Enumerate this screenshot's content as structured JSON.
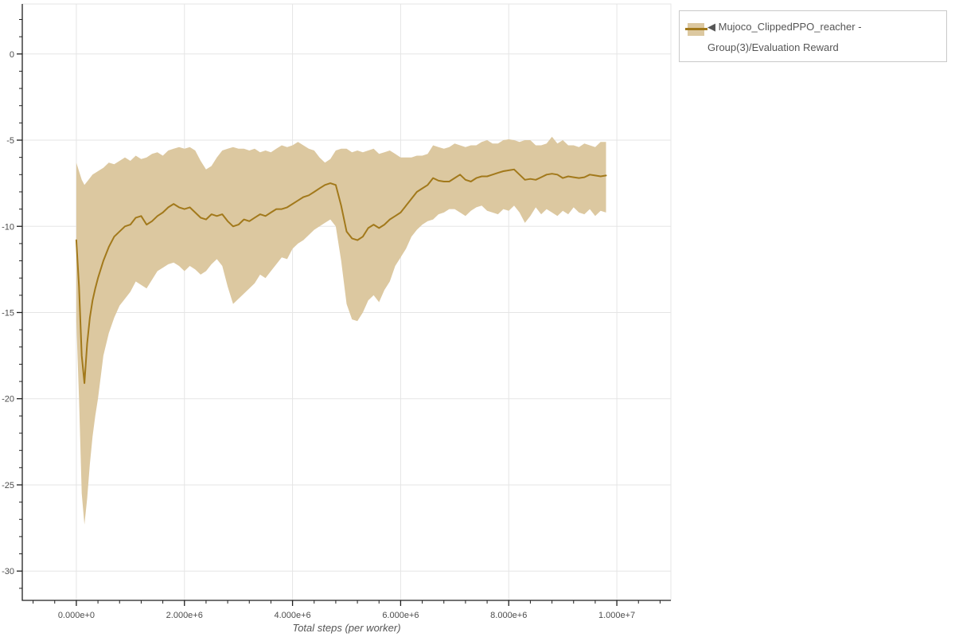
{
  "legend": {
    "label": "◀ Mujoco_ClippedPPO_reacher - Group(3)/Evaluation Reward",
    "swatch_fill": "#dcc8a0",
    "swatch_line": "#a2791b"
  },
  "chart_data": {
    "type": "line",
    "title": "",
    "xlabel": "Total steps (per worker)",
    "ylabel": "",
    "series": [
      {
        "name": "Mujoco_ClippedPPO_reacher - Group(3)/Evaluation Reward",
        "x_unit_steps": 1000000,
        "x_e6": [
          0,
          0.05,
          0.1,
          0.15,
          0.2,
          0.25,
          0.3,
          0.35,
          0.4,
          0.5,
          0.6,
          0.7,
          0.8,
          0.9,
          1.0,
          1.1,
          1.2,
          1.3,
          1.4,
          1.5,
          1.6,
          1.7,
          1.8,
          1.9,
          2.0,
          2.1,
          2.2,
          2.3,
          2.4,
          2.5,
          2.6,
          2.7,
          2.8,
          2.9,
          3.0,
          3.1,
          3.2,
          3.3,
          3.4,
          3.5,
          3.6,
          3.7,
          3.8,
          3.9,
          4.0,
          4.1,
          4.2,
          4.3,
          4.4,
          4.5,
          4.6,
          4.7,
          4.8,
          4.9,
          5.0,
          5.1,
          5.2,
          5.3,
          5.4,
          5.5,
          5.6,
          5.7,
          5.8,
          5.9,
          6.0,
          6.1,
          6.2,
          6.3,
          6.4,
          6.5,
          6.6,
          6.7,
          6.8,
          6.9,
          7.0,
          7.1,
          7.2,
          7.3,
          7.4,
          7.5,
          7.6,
          7.7,
          7.8,
          7.9,
          8.0,
          8.1,
          8.2,
          8.3,
          8.4,
          8.5,
          8.6,
          8.7,
          8.8,
          8.9,
          9.0,
          9.1,
          9.2,
          9.3,
          9.4,
          9.5,
          9.6,
          9.7,
          9.8
        ],
        "mean": [
          -10.8,
          -13.5,
          -17.5,
          -19.1,
          -16.8,
          -15.3,
          -14.3,
          -13.6,
          -13.0,
          -12.0,
          -11.2,
          -10.6,
          -10.3,
          -10.0,
          -9.9,
          -9.5,
          -9.4,
          -9.9,
          -9.7,
          -9.4,
          -9.2,
          -8.9,
          -8.7,
          -8.9,
          -9.0,
          -8.9,
          -9.2,
          -9.5,
          -9.6,
          -9.3,
          -9.4,
          -9.3,
          -9.7,
          -10.0,
          -9.9,
          -9.6,
          -9.7,
          -9.5,
          -9.3,
          -9.4,
          -9.2,
          -9.0,
          -9.0,
          -8.9,
          -8.7,
          -8.5,
          -8.3,
          -8.2,
          -8.0,
          -7.8,
          -7.6,
          -7.5,
          -7.6,
          -8.8,
          -10.3,
          -10.7,
          -10.8,
          -10.6,
          -10.1,
          -9.9,
          -10.1,
          -9.9,
          -9.6,
          -9.4,
          -9.2,
          -8.8,
          -8.4,
          -8.0,
          -7.8,
          -7.6,
          -7.2,
          -7.35,
          -7.4,
          -7.4,
          -7.2,
          -7.0,
          -7.3,
          -7.4,
          -7.2,
          -7.1,
          -7.1,
          -7.0,
          -6.9,
          -6.8,
          -6.75,
          -6.7,
          -7.0,
          -7.3,
          -7.25,
          -7.3,
          -7.15,
          -7.0,
          -6.95,
          -7.0,
          -7.2,
          -7.1,
          -7.15,
          -7.2,
          -7.15,
          -7.0,
          -7.05,
          -7.1,
          -7.05
        ],
        "band_upper": [
          -6.3,
          -6.8,
          -7.3,
          -7.6,
          -7.4,
          -7.2,
          -7.0,
          -6.9,
          -6.8,
          -6.6,
          -6.3,
          -6.4,
          -6.2,
          -6.0,
          -6.2,
          -5.9,
          -6.1,
          -6.0,
          -5.8,
          -5.7,
          -5.9,
          -5.6,
          -5.5,
          -5.4,
          -5.5,
          -5.4,
          -5.6,
          -6.2,
          -6.7,
          -6.5,
          -6.0,
          -5.6,
          -5.5,
          -5.4,
          -5.5,
          -5.5,
          -5.6,
          -5.5,
          -5.7,
          -5.6,
          -5.7,
          -5.5,
          -5.3,
          -5.4,
          -5.3,
          -5.1,
          -5.3,
          -5.5,
          -5.6,
          -6.0,
          -6.3,
          -6.1,
          -5.6,
          -5.5,
          -5.5,
          -5.7,
          -5.6,
          -5.7,
          -5.6,
          -5.5,
          -5.8,
          -5.7,
          -5.6,
          -5.8,
          -6.0,
          -6.0,
          -6.0,
          -5.9,
          -5.9,
          -5.8,
          -5.3,
          -5.4,
          -5.5,
          -5.4,
          -5.2,
          -5.3,
          -5.4,
          -5.3,
          -5.3,
          -5.1,
          -5.0,
          -5.2,
          -5.2,
          -5.0,
          -4.95,
          -5.0,
          -5.1,
          -5.0,
          -5.0,
          -5.3,
          -5.3,
          -5.2,
          -4.8,
          -5.2,
          -5.0,
          -5.3,
          -5.3,
          -5.4,
          -5.2,
          -5.3,
          -5.4,
          -5.1,
          -5.1
        ],
        "band_lower": [
          -15.5,
          -20.0,
          -25.5,
          -27.3,
          -25.8,
          -23.8,
          -22.2,
          -21.0,
          -20.0,
          -17.5,
          -16.2,
          -15.3,
          -14.6,
          -14.2,
          -13.8,
          -13.2,
          -13.4,
          -13.6,
          -13.1,
          -12.6,
          -12.4,
          -12.2,
          -12.1,
          -12.3,
          -12.6,
          -12.3,
          -12.5,
          -12.8,
          -12.6,
          -12.2,
          -11.9,
          -12.3,
          -13.5,
          -14.5,
          -14.2,
          -13.9,
          -13.6,
          -13.3,
          -12.8,
          -13.0,
          -12.6,
          -12.2,
          -11.8,
          -11.9,
          -11.3,
          -11.0,
          -10.8,
          -10.5,
          -10.2,
          -10.0,
          -9.8,
          -9.6,
          -10.0,
          -12.0,
          -14.5,
          -15.4,
          -15.5,
          -15.0,
          -14.3,
          -14.0,
          -14.4,
          -13.7,
          -13.2,
          -12.3,
          -11.8,
          -11.3,
          -10.6,
          -10.2,
          -9.9,
          -9.7,
          -9.6,
          -9.3,
          -9.2,
          -9.0,
          -9.0,
          -9.2,
          -9.4,
          -9.1,
          -8.9,
          -8.8,
          -9.1,
          -9.2,
          -9.3,
          -9.0,
          -9.1,
          -8.8,
          -9.2,
          -9.8,
          -9.4,
          -8.9,
          -9.3,
          -9.0,
          -9.2,
          -9.4,
          -9.1,
          -9.3,
          -8.9,
          -9.2,
          -9.3,
          -9.0,
          -9.4,
          -9.1,
          -9.2
        ]
      }
    ],
    "x_domain": [
      -1000000,
      11000000
    ],
    "y_domain": [
      -31.7,
      2.9
    ],
    "x_major_ticks": [
      {
        "v": 0,
        "label": "0.000e+0"
      },
      {
        "v": 2000000,
        "label": "2.000e+6"
      },
      {
        "v": 4000000,
        "label": "4.000e+6"
      },
      {
        "v": 6000000,
        "label": "6.000e+6"
      },
      {
        "v": 8000000,
        "label": "8.000e+6"
      },
      {
        "v": 10000000,
        "label": "1.000e+7"
      }
    ],
    "y_major_ticks": [
      {
        "v": 0,
        "label": "0"
      },
      {
        "v": -5,
        "label": "-5"
      },
      {
        "v": -10,
        "label": "-10"
      },
      {
        "v": -15,
        "label": "-15"
      },
      {
        "v": -20,
        "label": "-20"
      },
      {
        "v": -25,
        "label": "-25"
      },
      {
        "v": -30,
        "label": "-30"
      }
    ],
    "x_minor_step": 400000,
    "y_minor_step": 1,
    "grid": true,
    "legend_position": "outside-top-right",
    "colors": {
      "band": "#dcc8a0",
      "line": "#a2791b",
      "grid": "#e5e5e5",
      "axis": "#1f1f1f",
      "tick_label": "#4d4d4d",
      "axis_title": "#565656"
    }
  }
}
